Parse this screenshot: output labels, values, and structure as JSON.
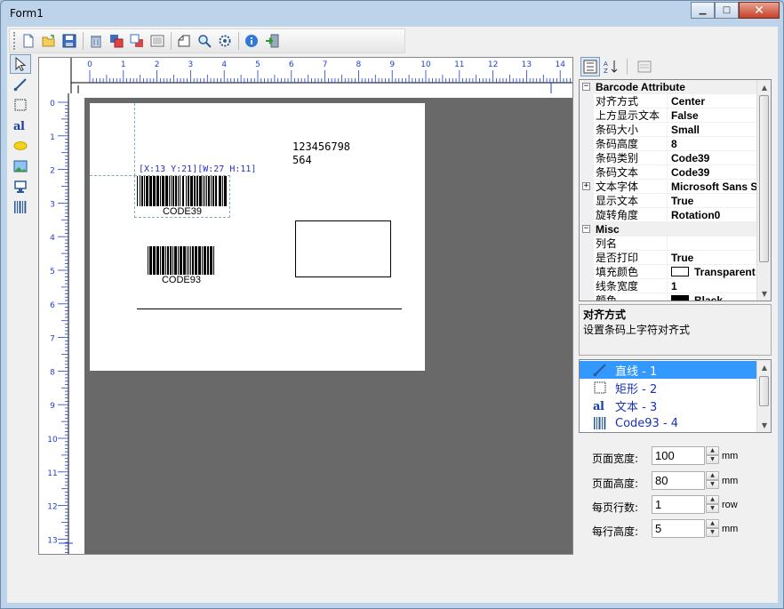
{
  "window": {
    "title": "Form1",
    "minimize": "▁",
    "maximize": "□",
    "close": "✕"
  },
  "toolbar": {
    "icons": [
      "new-file-icon",
      "open-folder-icon",
      "save-icon",
      "delete-icon",
      "bring-front-icon",
      "send-back-icon",
      "properties-icon",
      "print-preview-icon",
      "zoom-icon",
      "settings-icon",
      "info-icon",
      "exit-icon"
    ]
  },
  "tools": [
    "pointer-tool",
    "line-tool",
    "rectangle-tool",
    "text-tool",
    "ellipse-tool",
    "image-tool",
    "tag-tool",
    "barcode-tool"
  ],
  "ruler": {
    "h_labels": [
      "0",
      "1",
      "2",
      "3",
      "4",
      "5",
      "6",
      "7",
      "8",
      "9",
      "10",
      "11",
      "12",
      "13",
      "14"
    ],
    "v_labels": [
      "0",
      "1",
      "2",
      "3",
      "4",
      "5",
      "6",
      "7",
      "8",
      "9",
      "10",
      "11",
      "12",
      "13"
    ]
  },
  "canvas": {
    "sel_info": "[X:13 Y:21][W:27 H:11]",
    "text_line1": "123456798",
    "text_line2": "564",
    "barcode1_label": "CODE39",
    "barcode2_label": "CODE93"
  },
  "property_grid": {
    "category1": "Barcode Attribute",
    "rows1": [
      {
        "name": "对齐方式",
        "value": "Center"
      },
      {
        "name": "上方显示文本",
        "value": "False"
      },
      {
        "name": "条码大小",
        "value": "Small"
      },
      {
        "name": "条码高度",
        "value": "8"
      },
      {
        "name": "条码类别",
        "value": "Code39"
      },
      {
        "name": "条码文本",
        "value": "Code39"
      },
      {
        "name": "文本字体",
        "value": "Microsoft Sans S"
      },
      {
        "name": "显示文本",
        "value": "True"
      },
      {
        "name": "旋转角度",
        "value": "Rotation0"
      }
    ],
    "category2": "Misc",
    "rows2": [
      {
        "name": "列名",
        "value": ""
      },
      {
        "name": "是否打印",
        "value": "True"
      },
      {
        "name": "填充颜色",
        "value": "Transparent"
      },
      {
        "name": "线条宽度",
        "value": "1"
      },
      {
        "name": "颜色",
        "value": "Black"
      }
    ]
  },
  "help": {
    "title": "对齐方式",
    "description": "设置条码上字符对齐式"
  },
  "object_list": [
    {
      "icon": "line-icon",
      "label": "直线 - 1",
      "selected": true
    },
    {
      "icon": "rectangle-icon",
      "label": "矩形 - 2",
      "selected": false
    },
    {
      "icon": "text-icon",
      "label": "文本 - 3",
      "selected": false
    },
    {
      "icon": "barcode-icon",
      "label": "Code93 - 4",
      "selected": false
    }
  ],
  "page_settings": {
    "width": {
      "label": "页面宽度:",
      "value": "100",
      "unit": "mm"
    },
    "height": {
      "label": "页面高度:",
      "value": "80",
      "unit": "mm"
    },
    "rows": {
      "label": "每页行数:",
      "value": "1",
      "unit": "row"
    },
    "row_height": {
      "label": "每行高度:",
      "value": "5",
      "unit": "mm"
    }
  },
  "colors": {
    "selection": "#3399ff",
    "list_text": "#1a32b0",
    "canvas_bg": "#696969",
    "ruler_blue": "#1f3fd0"
  }
}
